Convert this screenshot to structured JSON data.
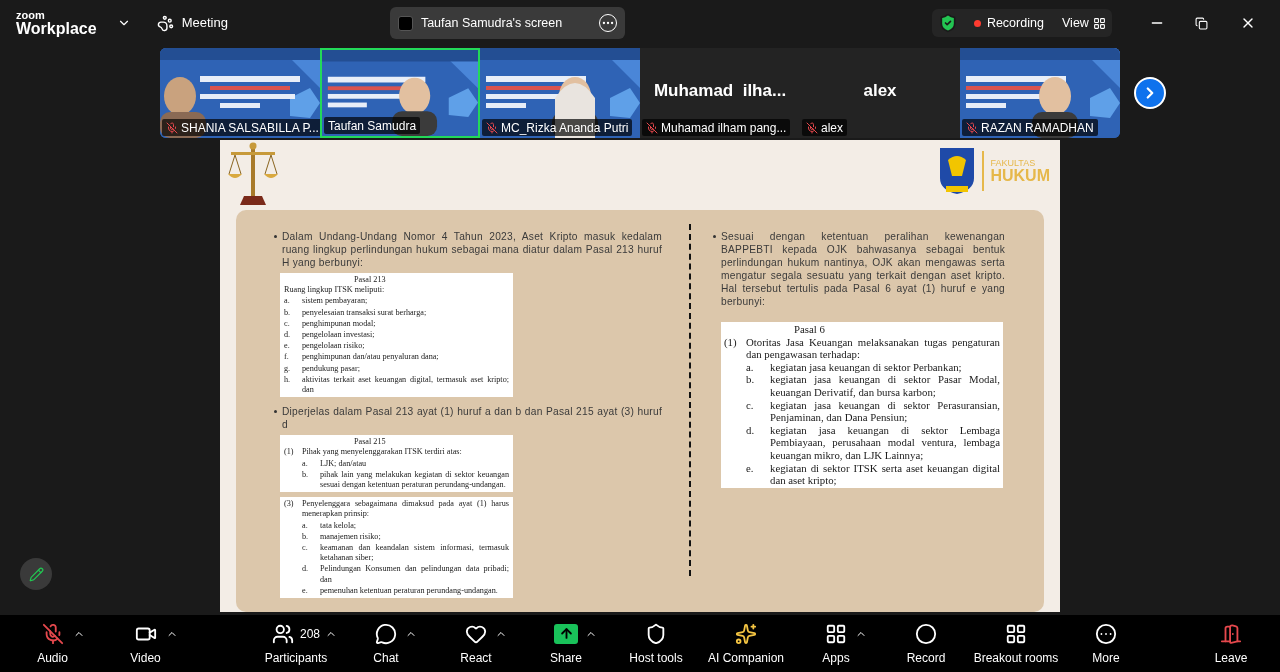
{
  "top_bar": {
    "brand_top": "zoom",
    "brand_bottom": "Workplace",
    "meeting": "Meeting",
    "share_label": "Taufan Samudra's screen",
    "recording": true,
    "recording_label": "Recording",
    "view": "View"
  },
  "participants": [
    {
      "name": "SHANIA SALSABILLA P...",
      "kind": "video",
      "muted": true,
      "selected": false
    },
    {
      "name": "Taufan Samudra",
      "kind": "video",
      "muted": false,
      "selected": true
    },
    {
      "name": "MC_Rizka Ananda Putri",
      "kind": "video",
      "muted": true,
      "selected": false
    },
    {
      "name": "Muhamad ilham pang...",
      "kind": "name",
      "display_name": "Muhamad  ilha...",
      "muted": true,
      "selected": false
    },
    {
      "name": "alex",
      "kind": "name",
      "display_name": "alex",
      "muted": true,
      "selected": false
    },
    {
      "name": "RAZAN RAMADHAN",
      "kind": "video",
      "muted": true,
      "selected": false
    }
  ],
  "slide": {
    "faculty_top": "FAKULTAS",
    "faculty_bottom": "HUKUM",
    "left": [
      {
        "kind": "bullet",
        "text": "Dalam Undang-Undang Nomor 4 Tahun 2023, Aset Kripto masuk kedalam ruang lingkup perlindungan hukum sebagai mana diatur dalam Pasal 213 huruf H yang berbunyi:"
      },
      {
        "kind": "box",
        "title": "Pasal 213",
        "clauses": [
          {
            "text": "Ruang lingkup ITSK meliputi:",
            "items": [
              {
                "letter": "a.",
                "text": "sistem pembayaran;"
              },
              {
                "letter": "b.",
                "text": "penyelesaian transaksi surat berharga;"
              },
              {
                "letter": "c.",
                "text": "penghimpunan modal;"
              },
              {
                "letter": "d.",
                "text": "pengelolaan investasi;"
              },
              {
                "letter": "e.",
                "text": "pengelolaan risiko;"
              },
              {
                "letter": "f.",
                "text": "penghimpunan dan/atau penyaluran dana;"
              },
              {
                "letter": "g.",
                "text": "pendukung pasar;"
              },
              {
                "letter": "h.",
                "text": "aktivitas terkait aset keuangan digital, termasuk aset kripto; dan"
              }
            ]
          }
        ]
      },
      {
        "kind": "bullet",
        "text": "Diperjelas dalam Pasal 213 ayat (1) huruf a dan b dan Pasal 215 ayat (3) huruf d"
      },
      {
        "kind": "box",
        "title": "Pasal 215",
        "clauses": [
          {
            "num": "(1)",
            "text": "Pihak yang menyelenggarakan ITSK terdiri atas:",
            "items": [
              {
                "letter": "a.",
                "text": "LJK; dan/atau"
              },
              {
                "letter": "b.",
                "text": "pihak lain yang melakukan kegiatan di sektor keuangan sesuai dengan ketentuan peraturan perundang-undangan."
              }
            ]
          }
        ]
      },
      {
        "kind": "box",
        "clauses": [
          {
            "num": "(3)",
            "text": "Penyelenggara sebagaimana dimaksud pada ayat (1) harus menerapkan prinsip:",
            "items": [
              {
                "letter": "a.",
                "text": "tata kelola;"
              },
              {
                "letter": "b.",
                "text": "manajemen risiko;"
              },
              {
                "letter": "c.",
                "text": "keamanan dan keandalan sistem informasi, termasuk ketahanan siber;"
              },
              {
                "letter": "d.",
                "text": "Pelindungan Konsumen dan pelindungan data pribadi; dan"
              },
              {
                "letter": "e.",
                "text": "pemenuhan ketentuan peraturan perundang-undangan."
              }
            ]
          }
        ]
      }
    ],
    "right": [
      {
        "kind": "bullet",
        "text": "Sesuai dengan ketentuan peralihan kewenangan BAPPEBTI kepada OJK bahwasanya sebagai bentuk perlindungan hukum nantinya, OJK akan mengawas serta mengatur segala sesuatu yang terkait dengan aset kripto. Hal tersebut tertulis pada Pasal 6 ayat (1) huruf e yang berbunyi:"
      },
      {
        "kind": "box",
        "title": "Pasal 6",
        "clauses": [
          {
            "num": "(1)",
            "text": "Otoritas Jasa Keuangan melaksanakan tugas pengaturan dan pengawasan terhadap:",
            "items": [
              {
                "letter": "a.",
                "text": "kegiatan jasa keuangan di sektor Perbankan;"
              },
              {
                "letter": "b.",
                "text": "kegiatan jasa keuangan di sektor Pasar Modal, keuangan Derivatif, dan bursa karbon;"
              },
              {
                "letter": "c.",
                "text": "kegiatan jasa keuangan di sektor Perasuransian, Penjaminan, dan Dana Pensiun;"
              },
              {
                "letter": "d.",
                "text": "kegiatan jasa keuangan di sektor Lembaga Pembiayaan, perusahaan modal ventura, lembaga keuangan mikro, dan LJK Lainnya;"
              },
              {
                "letter": "e.",
                "text": "kegiatan di sektor ITSK serta aset keuangan digital dan aset kripto;"
              }
            ]
          }
        ]
      }
    ]
  },
  "toolbar": [
    {
      "kind": "audio",
      "label": "Audio",
      "caret": true,
      "muted": true
    },
    {
      "kind": "video",
      "label": "Video",
      "caret": true
    },
    {
      "kind": "participants",
      "label": "Participants",
      "count": "208",
      "caret": true
    },
    {
      "kind": "chat",
      "label": "Chat",
      "caret": true
    },
    {
      "kind": "react",
      "label": "React",
      "caret": true
    },
    {
      "kind": "share",
      "label": "Share",
      "caret": true
    },
    {
      "kind": "host",
      "label": "Host tools",
      "caret": false
    },
    {
      "kind": "ai",
      "label": "AI Companion",
      "caret": false
    },
    {
      "kind": "apps",
      "label": "Apps",
      "caret": true
    },
    {
      "kind": "record",
      "label": "Record",
      "caret": false
    },
    {
      "kind": "breakout",
      "label": "Breakout rooms",
      "caret": false
    },
    {
      "kind": "more",
      "label": "More",
      "caret": false
    },
    {
      "kind": "leave",
      "label": "Leave",
      "caret": false
    }
  ]
}
